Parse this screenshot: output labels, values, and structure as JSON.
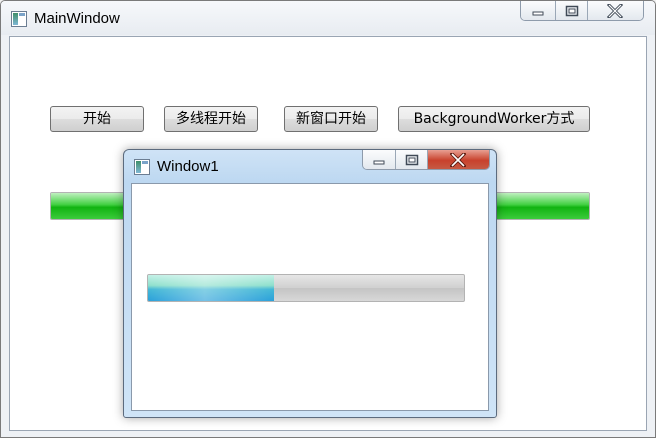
{
  "main_window": {
    "title": "MainWindow",
    "buttons": {
      "start": "开始",
      "multithread_start": "多线程开始",
      "new_window_start": "新窗口开始",
      "background_worker": "BackgroundWorker方式"
    },
    "progress": {
      "value_fraction": 1.0,
      "color": "#22c022"
    }
  },
  "child_window": {
    "title": "Window1",
    "progress": {
      "value_fraction": 0.4,
      "color": "#2aa0da"
    }
  },
  "icons": [
    "app-icon",
    "minimize-icon",
    "maximize-icon",
    "close-icon"
  ]
}
